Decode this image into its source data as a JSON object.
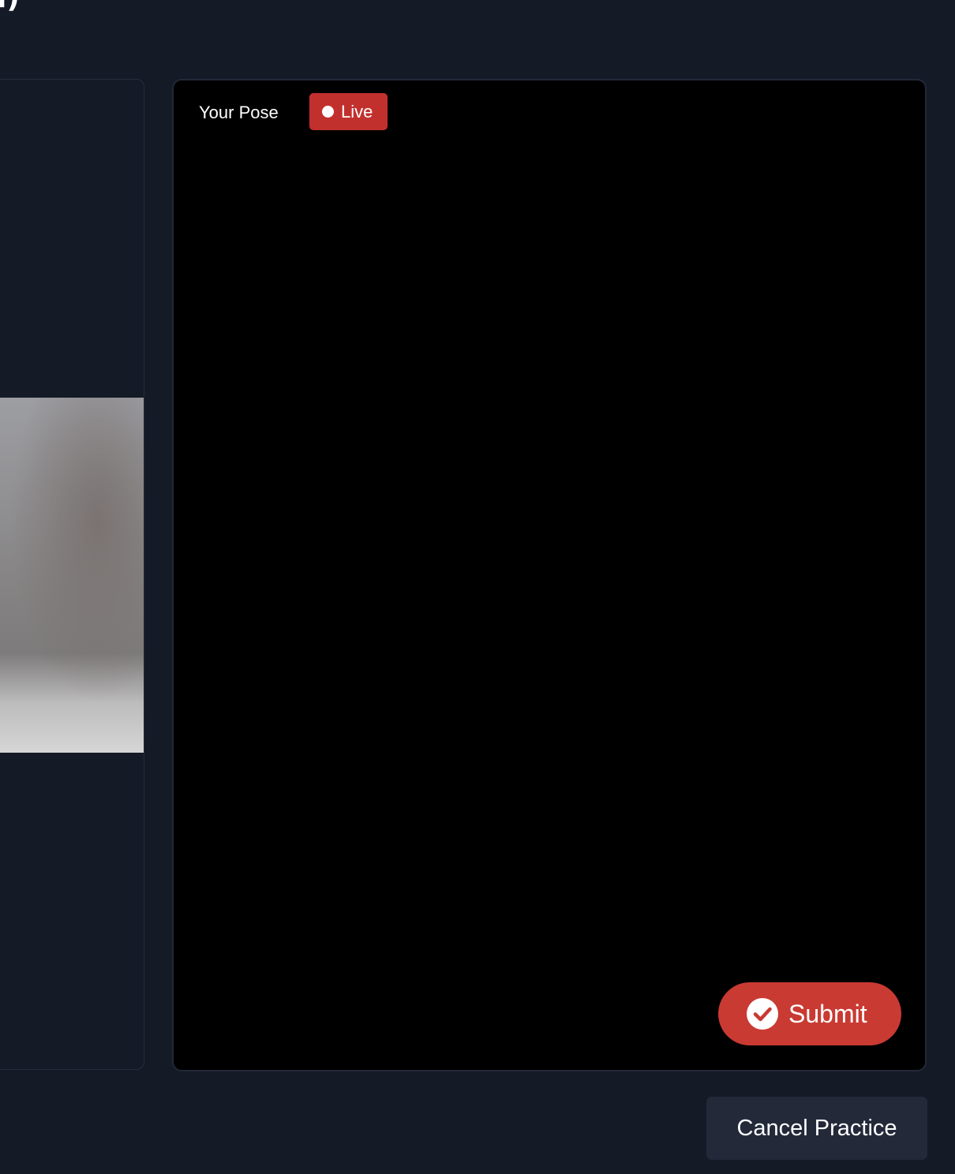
{
  "header": {
    "title_fragment": "l)"
  },
  "camera": {
    "title": "Your Pose",
    "live_label": "Live",
    "submit_label": "Submit"
  },
  "actions": {
    "cancel_label": "Cancel Practice"
  },
  "colors": {
    "background": "#151a27",
    "accent_red": "#c93a32",
    "live_badge": "#c2302d",
    "camera_feed": "#000000",
    "secondary_button": "#232939"
  },
  "icons": {
    "submit": "check-circle-icon",
    "live": "live-dot-icon"
  }
}
